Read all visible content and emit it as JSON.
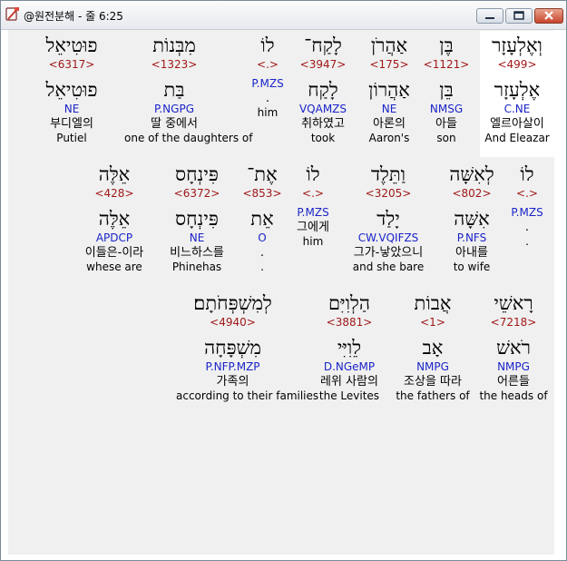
{
  "window": {
    "title": "@원전분해 - 줄 6:25",
    "icon": "bible-app-icon"
  },
  "rows": [
    {
      "words": [
        {
          "hebrew": "וְאֶלְעָזָר",
          "strong": "<499>",
          "lemma": "אֶלְעָזָר",
          "morph": "C.NE",
          "korean": "엘르아살이",
          "english": "And Eleazar",
          "highlighted": true
        },
        {
          "hebrew": "בֶּן",
          "strong": "<1121>",
          "lemma": "בֵּן",
          "morph": "NMSG",
          "korean": "아들",
          "english": "son"
        },
        {
          "hebrew": "אַהֲרֹן",
          "strong": "<175>",
          "lemma": "אַהֲרוֹן",
          "morph": "NE",
          "korean": "아론의",
          "english": "Aaron's"
        },
        {
          "hebrew": "לָקַח־",
          "strong": "<3947>",
          "lemma": "לָקַח",
          "morph": "VQAMZS",
          "korean": "취하였고",
          "english": "took"
        },
        {
          "hebrew": "לוֹ",
          "strong": "<.>",
          "lemma": "",
          "morph": "P.MZS",
          "korean": ".",
          "english": "him"
        },
        {
          "hebrew": "מִבְּנוֹת",
          "strong": "<1323>",
          "lemma": "בַּת",
          "morph": "P.NGPG",
          "korean": "딸 중에서",
          "english": "one of the daughters of"
        },
        {
          "hebrew": "פוּטִיאֵל",
          "strong": "<6317>",
          "lemma": "פוּטִיאֵל",
          "morph": "NE",
          "korean": "부디엘의",
          "english": "Putiel"
        }
      ]
    },
    {
      "words": [
        {
          "hebrew": "לוֹ",
          "strong": "<.>",
          "lemma": "",
          "morph": "P.MZS",
          "korean": ".",
          "english": "."
        },
        {
          "hebrew": "לְאִשָּׁה",
          "strong": "<802>",
          "lemma": "אִשָּׁה",
          "morph": "P.NFS",
          "korean": "아내를",
          "english": "to wife"
        },
        {
          "hebrew": "וַתֵּלֶד",
          "strong": "<3205>",
          "lemma": "יָלַד",
          "morph": "CW.VQIFZS",
          "korean": "그가-낳았으니",
          "english": "and she bare"
        },
        {
          "hebrew": "לוֹ",
          "strong": "<.>",
          "lemma": "",
          "morph": "P.MZS",
          "korean": "그에게",
          "english": "him"
        },
        {
          "hebrew": "אֶת־",
          "strong": "<853>",
          "lemma": "אֵת",
          "morph": "O",
          "korean": ".",
          "english": "."
        },
        {
          "hebrew": "פִּינְחָס",
          "strong": "<6372>",
          "lemma": "פִּינְחָס",
          "morph": "NE",
          "korean": "비느하스를",
          "english": "Phinehas"
        },
        {
          "hebrew": "אֵלֶּה",
          "strong": "<428>",
          "lemma": "אֵלֶּה",
          "morph": "APDCP",
          "korean": "이들은-이라",
          "english": "whese are"
        }
      ]
    },
    {
      "words": [
        {
          "hebrew": "רָאשֵׁי",
          "strong": "<7218>",
          "lemma": "רֹאשׁ",
          "morph": "NMPG",
          "korean": "어른들",
          "english": "the heads of"
        },
        {
          "hebrew": "אֲבוֹת",
          "strong": "<1>",
          "lemma": "אָב",
          "morph": "NMPG",
          "korean": "조상을 따라",
          "english": "the fathers of"
        },
        {
          "hebrew": "הַלְוִיִּם",
          "strong": "<3881>",
          "lemma": "לֵוִיִּי",
          "morph": "D.NGeMP",
          "korean": "레위 사람의",
          "english": "the Levites"
        },
        {
          "hebrew": "לְמִשְׁפְּחֹתָם׃",
          "strong": "<4940>",
          "lemma": "מִשְׁפָּחָה",
          "morph": "P.NFP.MZP",
          "korean": "가족의",
          "english": "according to their families"
        }
      ]
    }
  ]
}
